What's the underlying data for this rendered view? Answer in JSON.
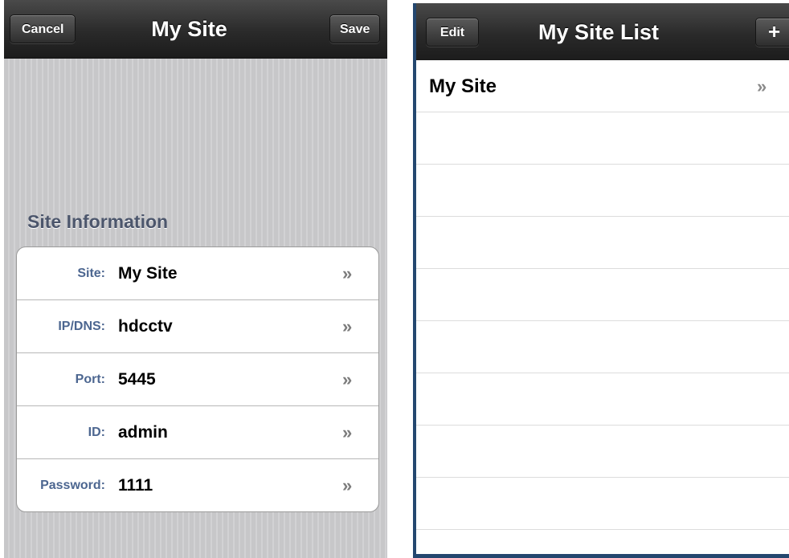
{
  "edit_screen": {
    "nav": {
      "title": "My Site",
      "cancel_label": "Cancel",
      "save_label": "Save"
    },
    "section_header": "Site Information",
    "fields": [
      {
        "label": "Site:",
        "value": "My Site"
      },
      {
        "label": "IP/DNS:",
        "value": "hdcctv"
      },
      {
        "label": "Port:",
        "value": "5445"
      },
      {
        "label": "ID:",
        "value": "admin"
      },
      {
        "label": "Password:",
        "value": "1111"
      }
    ],
    "chevron": "»"
  },
  "list_screen": {
    "nav": {
      "title": "My Site List",
      "edit_label": "Edit",
      "add_label": "+"
    },
    "items": [
      {
        "label": "My Site"
      }
    ],
    "chevron": "»"
  },
  "colors": {
    "navbar": "#2a2a2a",
    "field_label": "#4c6690",
    "section_header": "#4c566c",
    "frame_blue": "#24476f"
  }
}
